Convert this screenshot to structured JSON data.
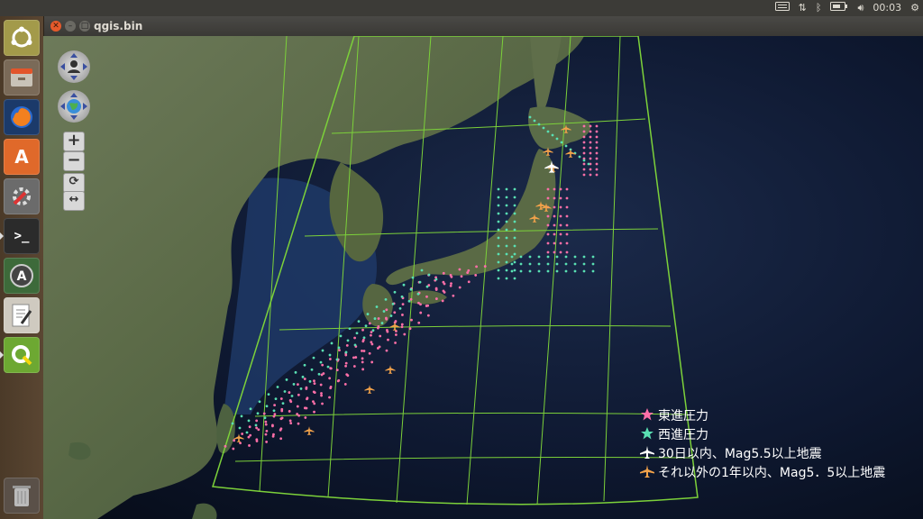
{
  "window": {
    "title": "qgis.bin"
  },
  "top_panel": {
    "clock": "00:03",
    "icons": [
      "keyboard-icon",
      "network-icon",
      "bluetooth-icon",
      "battery-icon",
      "volume-icon",
      "gear-icon"
    ]
  },
  "launcher": {
    "apps": [
      "ubuntu-dash",
      "files",
      "firefox",
      "software-center",
      "system-settings",
      "terminal",
      "software-updater",
      "text-editor",
      "qgis",
      "trash"
    ]
  },
  "legend": {
    "items": [
      {
        "label": "東進圧力",
        "color": "#ff6fa8",
        "symbol": "star-icon"
      },
      {
        "label": "西進圧力",
        "color": "#59e0b3",
        "symbol": "star-icon"
      },
      {
        "label": "30日以内、Mag5.5以上地震",
        "color": "#ffffff",
        "symbol": "airplane-icon"
      },
      {
        "label": "それ以外の1年以内、Mag5．5以上地震",
        "color": "#f2a24a",
        "symbol": "airplane-icon"
      }
    ]
  },
  "colors": {
    "grid": "#7cd13a",
    "east_pressure": "#ff6fa8",
    "west_pressure": "#59e0b3",
    "quake_recent": "#ffffff",
    "quake_year": "#f2a24a"
  }
}
